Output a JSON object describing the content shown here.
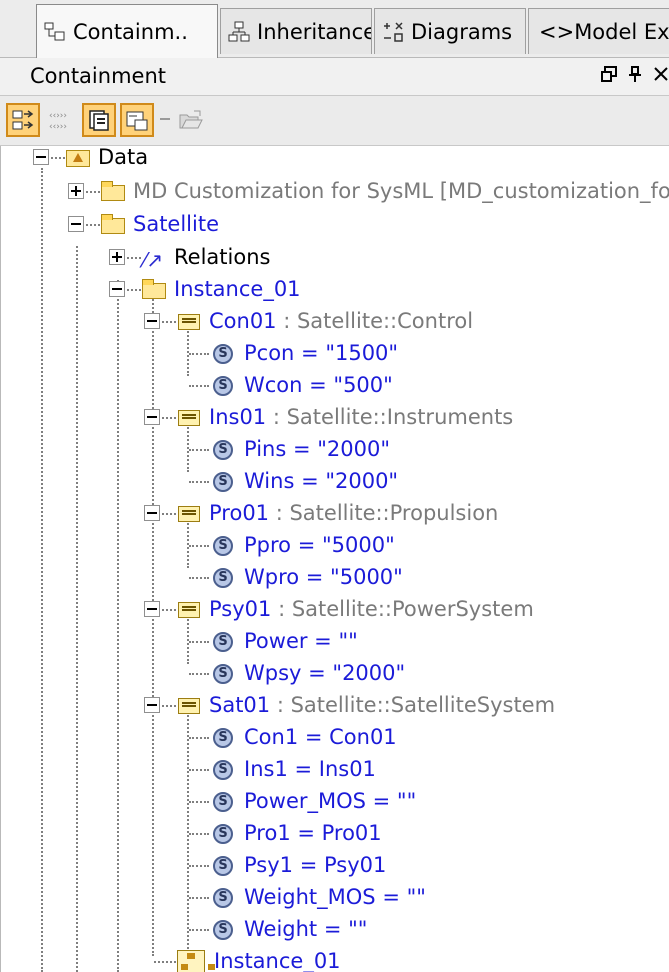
{
  "tabs": [
    {
      "label": "Containm.."
    },
    {
      "label": "Inheritance"
    },
    {
      "label": "Diagrams"
    },
    {
      "label": "<>Model Ext"
    }
  ],
  "panel": {
    "title": "Containment",
    "controls": [
      "restore-icon",
      "pin-icon",
      "close-icon"
    ]
  },
  "toolbar": {
    "buttons": [
      "expand-icon",
      "collapse-icon",
      "specification-icon",
      "filter-icon",
      "open-icon"
    ]
  },
  "tree": {
    "root": {
      "label": "Data"
    },
    "md_custom": {
      "label": "MD Customization for SysML [MD_customization_for_Sy"
    },
    "satellite": {
      "label": "Satellite"
    },
    "relations": {
      "label": "Relations"
    },
    "instance_folder": {
      "label": "Instance_01"
    },
    "con01": {
      "name": "Con01",
      "type": " : Satellite::Control",
      "slots": [
        "Pcon = \"1500\"",
        "Wcon = \"500\""
      ]
    },
    "ins01": {
      "name": "Ins01",
      "type": " : Satellite::Instruments",
      "slots": [
        "Pins = \"2000\"",
        "Wins = \"2000\""
      ]
    },
    "pro01": {
      "name": "Pro01",
      "type": " : Satellite::Propulsion",
      "slots": [
        "Ppro = \"5000\"",
        "Wpro = \"5000\""
      ]
    },
    "psy01": {
      "name": "Psy01",
      "type": " : Satellite::PowerSystem",
      "slots": [
        "Power = \"\"",
        "Wpsy = \"2000\""
      ]
    },
    "sat01": {
      "name": "Sat01",
      "type": " : Satellite::SatelliteSystem",
      "slots": [
        "Con1 = Con01",
        "Ins1 = Ins01",
        "Power_MOS = \"\"",
        "Pro1 = Pro01",
        "Psy1 = Psy01",
        "Weight_MOS = \"\"",
        "Weight = \"\""
      ]
    },
    "instance_diagram": {
      "label": "Instance_01"
    }
  },
  "colors": {
    "link_blue": "#1b1bd8",
    "gray_text": "#7a7a7a",
    "toolbar_active": "#ffd27a"
  }
}
